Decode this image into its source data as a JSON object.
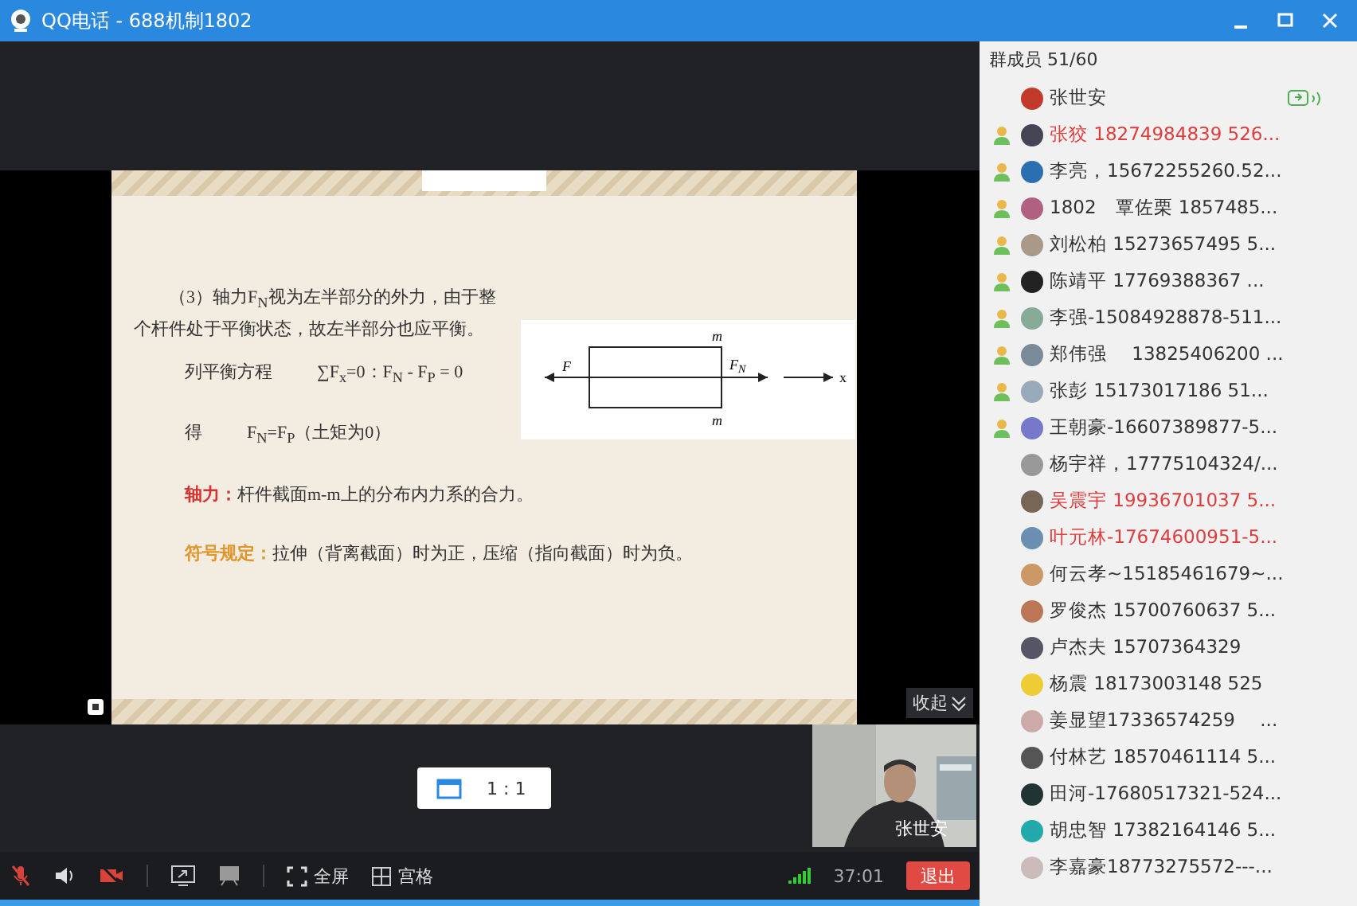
{
  "window": {
    "title": "QQ电话 - 688机制1802"
  },
  "slide": {
    "paragraph": "（3）轴力F$_{N}$视为左半部分的外力，由于整个杆件处于平衡状态，故左半部分也应平衡。",
    "equation_label": "列平衡方程",
    "equation": "∑F$_{x}$=0：F$_{N}$ - F$_{P}$ = 0",
    "result_label": "得",
    "result": "F$_{N}$=F$_{P}$（土矩为0）",
    "definitions": [
      {
        "term": "轴力：",
        "text": "杆件截面m-m上的分布内力系的合力。",
        "color": "#d8332e"
      },
      {
        "term": "符号规定：",
        "text": "拉伸（背离截面）时为正，压缩（指向截面）时为负。",
        "color": "#e0962c"
      }
    ],
    "diagram": {
      "left_force": "F",
      "right_force": "F",
      "right_force_sub": "N",
      "axis": "x",
      "section_top": "m",
      "section_bottom": "m"
    }
  },
  "collapse_button": "收起",
  "ratio_popup": "1 : 1",
  "camera": {
    "name": "张世安"
  },
  "toolbar": {
    "mic_muted": true,
    "camera_off": true,
    "fullscreen": "全屏",
    "grid": "宫格",
    "timer": "37:01",
    "exit": "退出"
  },
  "members": {
    "header": "群成员 51/60",
    "items": [
      {
        "text": "张世安",
        "color": "#333333",
        "admin": false,
        "speaking": true
      },
      {
        "text": "张狡 18274984839  526...",
        "color": "#e03c3c",
        "admin": true,
        "speaking": false
      },
      {
        "text": "李亮，15672255260.52...",
        "color": "#333333",
        "admin": true,
        "speaking": false
      },
      {
        "text": "1802　覃佐栗  1857485...",
        "color": "#333333",
        "admin": true,
        "speaking": false
      },
      {
        "text": "刘松柏 15273657495  5...",
        "color": "#333333",
        "admin": true,
        "speaking": false
      },
      {
        "text": "陈靖平  17769388367  ...",
        "color": "#333333",
        "admin": true,
        "speaking": false
      },
      {
        "text": "李强-15084928878-511...",
        "color": "#333333",
        "admin": true,
        "speaking": false
      },
      {
        "text": "郑伟强　 13825406200 ...",
        "color": "#333333",
        "admin": true,
        "speaking": false
      },
      {
        "text": "张彭  15173017186  51...",
        "color": "#333333",
        "admin": true,
        "speaking": false
      },
      {
        "text": "王朝豪-16607389877-5...",
        "color": "#333333",
        "admin": true,
        "speaking": false
      },
      {
        "text": "杨宇祥，17775104324/...",
        "color": "#333333",
        "admin": false,
        "speaking": false
      },
      {
        "text": "吴震宇  19936701037 5...",
        "color": "#e03c3c",
        "admin": false,
        "speaking": false
      },
      {
        "text": "叶元林-17674600951-5...",
        "color": "#e03c3c",
        "admin": false,
        "speaking": false
      },
      {
        "text": "何云孝~15185461679~...",
        "color": "#333333",
        "admin": false,
        "speaking": false
      },
      {
        "text": "罗俊杰 15700760637 5...",
        "color": "#333333",
        "admin": false,
        "speaking": false
      },
      {
        "text": "卢杰夫 15707364329",
        "color": "#333333",
        "admin": false,
        "speaking": false
      },
      {
        "text": "杨震 18173003148 525",
        "color": "#333333",
        "admin": false,
        "speaking": false
      },
      {
        "text": "姜显望17336574259　 ...",
        "color": "#333333",
        "admin": false,
        "speaking": false
      },
      {
        "text": "付林艺 18570461114  5...",
        "color": "#333333",
        "admin": false,
        "speaking": false
      },
      {
        "text": "田河-17680517321-524...",
        "color": "#333333",
        "admin": false,
        "speaking": false
      },
      {
        "text": "胡忠智 17382164146 5...",
        "color": "#333333",
        "admin": false,
        "speaking": false
      },
      {
        "text": "李嘉豪18773275572---...",
        "color": "#333333",
        "admin": false,
        "speaking": false
      }
    ]
  }
}
